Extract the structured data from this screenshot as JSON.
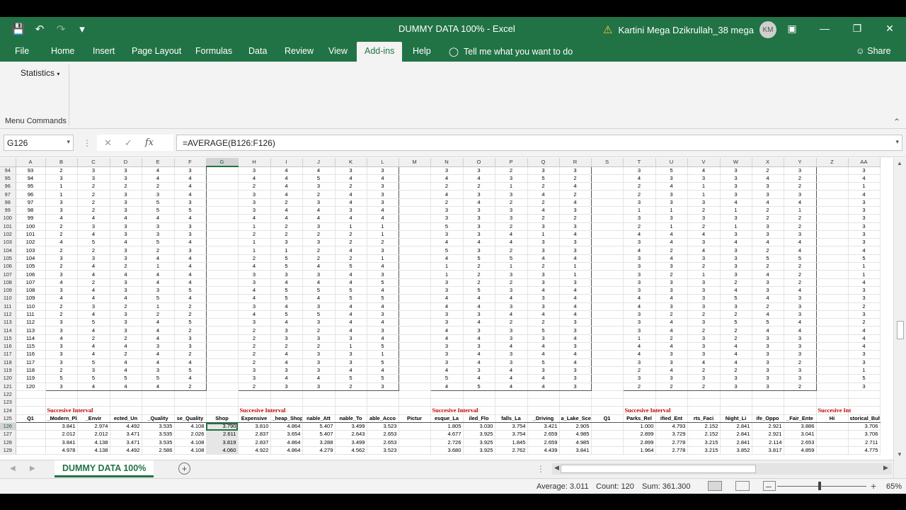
{
  "window": {
    "title": "DUMMY DATA 100%  -  Excel",
    "user_name": "Kartini Mega Dzikrullah_38 mega",
    "user_initials": "KM"
  },
  "quick_access": {
    "icons": [
      "save-icon",
      "undo-icon",
      "redo-icon",
      "customize-icon"
    ]
  },
  "ribbon": {
    "tabs": [
      {
        "label": "File"
      },
      {
        "label": "Home"
      },
      {
        "label": "Insert"
      },
      {
        "label": "Page Layout"
      },
      {
        "label": "Formulas"
      },
      {
        "label": "Data"
      },
      {
        "label": "Review"
      },
      {
        "label": "View"
      },
      {
        "label": "Add-ins",
        "active": true
      },
      {
        "label": "Help"
      }
    ],
    "tell_me": "Tell me what you want to do",
    "share": "Share",
    "statistics_button": "Statistics",
    "group_label": "Menu Commands"
  },
  "formula_bar": {
    "name_box": "G126",
    "formula": "=AVERAGE(B126:F126)"
  },
  "grid": {
    "columns": [
      "A",
      "B",
      "C",
      "D",
      "E",
      "F",
      "G",
      "H",
      "I",
      "J",
      "K",
      "L",
      "M",
      "N",
      "O",
      "P",
      "Q",
      "R",
      "S",
      "T",
      "U",
      "V",
      "W",
      "X",
      "Y",
      "Z",
      "AA"
    ],
    "selected_column": "G",
    "active_row": "126",
    "data_rows": [
      {
        "r": "94",
        "a": "93",
        "b1": [
          "2",
          "3",
          "3",
          "4",
          "3"
        ],
        "b2": [
          "3",
          "4",
          "4",
          "3",
          "3"
        ],
        "b3": [
          "3",
          "3",
          "2",
          "3",
          "3"
        ],
        "b4": [
          "3",
          "5",
          "4",
          "3",
          "2",
          "3"
        ],
        "aa": "3"
      },
      {
        "r": "95",
        "a": "94",
        "b1": [
          "3",
          "3",
          "3",
          "4",
          "4"
        ],
        "b2": [
          "4",
          "4",
          "5",
          "4",
          "4"
        ],
        "b3": [
          "4",
          "4",
          "3",
          "5",
          "2"
        ],
        "b4": [
          "4",
          "3",
          "3",
          "3",
          "4",
          "2"
        ],
        "aa": "4"
      },
      {
        "r": "96",
        "a": "95",
        "b1": [
          "1",
          "2",
          "2",
          "2",
          "4"
        ],
        "b2": [
          "2",
          "4",
          "3",
          "2",
          "3"
        ],
        "b3": [
          "2",
          "2",
          "1",
          "2",
          "4"
        ],
        "b4": [
          "2",
          "4",
          "1",
          "3",
          "3",
          "2"
        ],
        "aa": "1"
      },
      {
        "r": "97",
        "a": "96",
        "b1": [
          "1",
          "2",
          "3",
          "3",
          "4"
        ],
        "b2": [
          "3",
          "4",
          "2",
          "4",
          "3"
        ],
        "b3": [
          "4",
          "3",
          "3",
          "4",
          "2"
        ],
        "b4": [
          "2",
          "3",
          "1",
          "3",
          "3",
          "3"
        ],
        "aa": "4"
      },
      {
        "r": "98",
        "a": "97",
        "b1": [
          "3",
          "2",
          "3",
          "5",
          "3"
        ],
        "b2": [
          "3",
          "2",
          "3",
          "4",
          "3"
        ],
        "b3": [
          "2",
          "4",
          "2",
          "2",
          "4"
        ],
        "b4": [
          "3",
          "3",
          "3",
          "4",
          "4",
          "4"
        ],
        "aa": "3"
      },
      {
        "r": "99",
        "a": "98",
        "b1": [
          "3",
          "2",
          "3",
          "5",
          "5"
        ],
        "b2": [
          "3",
          "4",
          "4",
          "3",
          "4"
        ],
        "b3": [
          "3",
          "3",
          "3",
          "4",
          "3"
        ],
        "b4": [
          "1",
          "1",
          "2",
          "1",
          "2",
          "1"
        ],
        "aa": "3"
      },
      {
        "r": "100",
        "a": "99",
        "b1": [
          "4",
          "4",
          "4",
          "4",
          "4"
        ],
        "b2": [
          "4",
          "4",
          "4",
          "4",
          "4"
        ],
        "b3": [
          "3",
          "3",
          "3",
          "2",
          "2"
        ],
        "b4": [
          "3",
          "3",
          "3",
          "3",
          "2",
          "2"
        ],
        "aa": "3"
      },
      {
        "r": "101",
        "a": "100",
        "b1": [
          "2",
          "3",
          "3",
          "3",
          "3"
        ],
        "b2": [
          "1",
          "2",
          "3",
          "1",
          "1"
        ],
        "b3": [
          "5",
          "3",
          "2",
          "3",
          "3"
        ],
        "b4": [
          "2",
          "1",
          "2",
          "1",
          "3",
          "2"
        ],
        "aa": "3"
      },
      {
        "r": "102",
        "a": "101",
        "b1": [
          "2",
          "4",
          "3",
          "3",
          "3"
        ],
        "b2": [
          "2",
          "2",
          "2",
          "2",
          "1"
        ],
        "b3": [
          "3",
          "3",
          "4",
          "1",
          "4"
        ],
        "b4": [
          "4",
          "4",
          "4",
          "3",
          "3",
          "3"
        ],
        "aa": "3"
      },
      {
        "r": "103",
        "a": "102",
        "b1": [
          "4",
          "5",
          "4",
          "5",
          "4"
        ],
        "b2": [
          "1",
          "3",
          "3",
          "2",
          "2"
        ],
        "b3": [
          "4",
          "4",
          "4",
          "3",
          "3"
        ],
        "b4": [
          "3",
          "4",
          "3",
          "4",
          "4",
          "4"
        ],
        "aa": "3"
      },
      {
        "r": "104",
        "a": "103",
        "b1": [
          "2",
          "2",
          "3",
          "2",
          "3"
        ],
        "b2": [
          "1",
          "1",
          "2",
          "4",
          "3"
        ],
        "b3": [
          "5",
          "3",
          "2",
          "3",
          "3"
        ],
        "b4": [
          "4",
          "2",
          "4",
          "3",
          "2",
          "4"
        ],
        "aa": "4"
      },
      {
        "r": "105",
        "a": "104",
        "b1": [
          "3",
          "3",
          "3",
          "4",
          "4"
        ],
        "b2": [
          "2",
          "5",
          "2",
          "2",
          "1"
        ],
        "b3": [
          "4",
          "5",
          "5",
          "4",
          "4"
        ],
        "b4": [
          "3",
          "4",
          "3",
          "3",
          "5",
          "5"
        ],
        "aa": "5"
      },
      {
        "r": "106",
        "a": "105",
        "b1": [
          "2",
          "4",
          "2",
          "1",
          "4"
        ],
        "b2": [
          "4",
          "5",
          "4",
          "5",
          "4"
        ],
        "b3": [
          "1",
          "2",
          "1",
          "2",
          "1"
        ],
        "b4": [
          "3",
          "3",
          "2",
          "3",
          "2",
          "2"
        ],
        "aa": "1"
      },
      {
        "r": "107",
        "a": "106",
        "b1": [
          "3",
          "4",
          "4",
          "4",
          "4"
        ],
        "b2": [
          "3",
          "3",
          "3",
          "4",
          "3"
        ],
        "b3": [
          "1",
          "2",
          "3",
          "3",
          "1"
        ],
        "b4": [
          "3",
          "2",
          "1",
          "3",
          "4",
          "2"
        ],
        "aa": "1"
      },
      {
        "r": "108",
        "a": "107",
        "b1": [
          "4",
          "2",
          "3",
          "4",
          "4"
        ],
        "b2": [
          "3",
          "4",
          "4",
          "4",
          "5"
        ],
        "b3": [
          "3",
          "2",
          "2",
          "3",
          "3"
        ],
        "b4": [
          "3",
          "3",
          "3",
          "2",
          "3",
          "2"
        ],
        "aa": "4"
      },
      {
        "r": "109",
        "a": "108",
        "b1": [
          "3",
          "4",
          "3",
          "3",
          "5"
        ],
        "b2": [
          "4",
          "5",
          "5",
          "5",
          "4"
        ],
        "b3": [
          "3",
          "5",
          "3",
          "4",
          "4"
        ],
        "b4": [
          "3",
          "3",
          "3",
          "4",
          "3",
          "4"
        ],
        "aa": "3"
      },
      {
        "r": "110",
        "a": "109",
        "b1": [
          "4",
          "4",
          "4",
          "5",
          "4"
        ],
        "b2": [
          "4",
          "5",
          "4",
          "5",
          "5"
        ],
        "b3": [
          "4",
          "4",
          "4",
          "3",
          "4"
        ],
        "b4": [
          "4",
          "4",
          "3",
          "5",
          "4",
          "3"
        ],
        "aa": "3"
      },
      {
        "r": "111",
        "a": "110",
        "b1": [
          "2",
          "3",
          "2",
          "1",
          "2"
        ],
        "b2": [
          "3",
          "4",
          "3",
          "4",
          "4"
        ],
        "b3": [
          "4",
          "4",
          "3",
          "3",
          "4"
        ],
        "b4": [
          "4",
          "3",
          "3",
          "3",
          "2",
          "3"
        ],
        "aa": "2"
      },
      {
        "r": "112",
        "a": "111",
        "b1": [
          "2",
          "4",
          "3",
          "2",
          "2"
        ],
        "b2": [
          "4",
          "5",
          "5",
          "4",
          "3"
        ],
        "b3": [
          "3",
          "3",
          "4",
          "4",
          "4"
        ],
        "b4": [
          "3",
          "2",
          "2",
          "2",
          "4",
          "3"
        ],
        "aa": "3"
      },
      {
        "r": "113",
        "a": "112",
        "b1": [
          "3",
          "5",
          "3",
          "4",
          "5"
        ],
        "b2": [
          "3",
          "4",
          "3",
          "4",
          "4"
        ],
        "b3": [
          "3",
          "4",
          "2",
          "2",
          "3"
        ],
        "b4": [
          "3",
          "4",
          "3",
          "5",
          "5",
          "4"
        ],
        "aa": "2"
      },
      {
        "r": "114",
        "a": "113",
        "b1": [
          "3",
          "4",
          "3",
          "4",
          "2"
        ],
        "b2": [
          "2",
          "3",
          "2",
          "4",
          "3"
        ],
        "b3": [
          "4",
          "3",
          "3",
          "5",
          "3"
        ],
        "b4": [
          "3",
          "4",
          "2",
          "2",
          "4",
          "4"
        ],
        "aa": "4"
      },
      {
        "r": "115",
        "a": "114",
        "b1": [
          "4",
          "2",
          "2",
          "4",
          "3"
        ],
        "b2": [
          "2",
          "3",
          "3",
          "3",
          "4"
        ],
        "b3": [
          "4",
          "4",
          "3",
          "3",
          "4"
        ],
        "b4": [
          "1",
          "2",
          "3",
          "2",
          "3",
          "3"
        ],
        "aa": "4"
      },
      {
        "r": "116",
        "a": "115",
        "b1": [
          "3",
          "4",
          "4",
          "3",
          "3"
        ],
        "b2": [
          "2",
          "2",
          "2",
          "1",
          "5"
        ],
        "b3": [
          "3",
          "3",
          "4",
          "4",
          "3"
        ],
        "b4": [
          "4",
          "4",
          "3",
          "4",
          "3",
          "3"
        ],
        "aa": "4"
      },
      {
        "r": "117",
        "a": "116",
        "b1": [
          "3",
          "4",
          "2",
          "4",
          "2"
        ],
        "b2": [
          "2",
          "4",
          "3",
          "3",
          "1"
        ],
        "b3": [
          "3",
          "4",
          "3",
          "4",
          "4"
        ],
        "b4": [
          "4",
          "3",
          "3",
          "4",
          "3",
          "3"
        ],
        "aa": "3"
      },
      {
        "r": "118",
        "a": "117",
        "b1": [
          "3",
          "5",
          "4",
          "4",
          "4"
        ],
        "b2": [
          "2",
          "4",
          "3",
          "3",
          "5"
        ],
        "b3": [
          "3",
          "4",
          "3",
          "5",
          "4"
        ],
        "b4": [
          "3",
          "3",
          "4",
          "4",
          "3",
          "2"
        ],
        "aa": "3"
      },
      {
        "r": "119",
        "a": "118",
        "b1": [
          "2",
          "3",
          "4",
          "3",
          "5"
        ],
        "b2": [
          "3",
          "3",
          "3",
          "4",
          "4"
        ],
        "b3": [
          "4",
          "3",
          "4",
          "3",
          "3"
        ],
        "b4": [
          "2",
          "4",
          "2",
          "2",
          "3",
          "3"
        ],
        "aa": "1"
      },
      {
        "r": "120",
        "a": "119",
        "b1": [
          "5",
          "5",
          "5",
          "5",
          "4"
        ],
        "b2": [
          "3",
          "4",
          "4",
          "5",
          "5"
        ],
        "b3": [
          "5",
          "4",
          "4",
          "4",
          "3"
        ],
        "b4": [
          "3",
          "3",
          "3",
          "3",
          "3",
          "3"
        ],
        "aa": "5"
      },
      {
        "r": "121",
        "a": "120",
        "b1": [
          "3",
          "4",
          "4",
          "4",
          "2"
        ],
        "b2": [
          "2",
          "3",
          "3",
          "2",
          "3"
        ],
        "b3": [
          "4",
          "5",
          "4",
          "4",
          "3"
        ],
        "b4": [
          "2",
          "2",
          "2",
          "3",
          "3",
          "2"
        ],
        "aa": "3"
      }
    ],
    "blank_rows": [
      "122",
      "123"
    ],
    "interval_label_row": "124",
    "interval_label": "Succesive Interval",
    "interval_label_last": "Succesive Int",
    "header_row": {
      "r": "125",
      "a": "Q1",
      "b1": [
        "_Modern_Plan",
        "_Envir",
        "ected_Un",
        "_Quality",
        "se_Quality"
      ],
      "g": "Shop",
      "b2": [
        "Expensive",
        "_heap_Shop",
        "nable_Att",
        "nable_To",
        "able_Acco"
      ],
      "m": "Pictur",
      "b3": [
        "esque_La",
        "iled_Flo",
        "falls_La",
        "_Driving",
        "a_Lake_Scenery"
      ],
      "s": "Q1",
      "b4": [
        "Parks_Rel",
        "ified_Ent",
        "rts_Faci",
        "Night_Li",
        "ife_Oppo",
        "_Fair_Ente"
      ],
      "z": "Hi",
      "aa": "storical_Buh"
    },
    "sv_rows": [
      {
        "r": "126",
        "b1": [
          "3.841",
          "2.974",
          "4.492",
          "3.535",
          "4.108"
        ],
        "g": "3.790",
        "b2": [
          "3.810",
          "4.864",
          "5.407",
          "3.499",
          "3.523"
        ],
        "b3": [
          "1.805",
          "3.030",
          "3.754",
          "3.421",
          "2.905"
        ],
        "b4": [
          "1.000",
          "4.793",
          "2.152",
          "2.841",
          "2.921",
          "3.886"
        ],
        "aa": "3.706"
      },
      {
        "r": "127",
        "b1": [
          "2.012",
          "2.012",
          "3.471",
          "3.535",
          "2.026"
        ],
        "g": "2.611",
        "b2": [
          "2.837",
          "3.654",
          "5.407",
          "2.643",
          "2.653"
        ],
        "b3": [
          "4.677",
          "3.925",
          "3.754",
          "2.659",
          "4.985"
        ],
        "b4": [
          "2.899",
          "3.729",
          "2.152",
          "2.841",
          "2.921",
          "3.041"
        ],
        "aa": "3.706"
      },
      {
        "r": "128",
        "b1": [
          "3.841",
          "4.138",
          "3.471",
          "3.535",
          "4.108"
        ],
        "g": "3.819",
        "b2": [
          "2.837",
          "4.864",
          "3.288",
          "3.499",
          "2.653"
        ],
        "b3": [
          "2.726",
          "3.925",
          "1.845",
          "2.659",
          "4.985"
        ],
        "b4": [
          "2.899",
          "2.778",
          "3.215",
          "2.841",
          "2.114",
          "2.653"
        ],
        "aa": "2.711"
      },
      {
        "r": "129",
        "b1": [
          "4.978",
          "4.138",
          "4.492",
          "2.586",
          "4.108"
        ],
        "g": "4.060",
        "b2": [
          "4.922",
          "4.864",
          "4.279",
          "4.562",
          "3.523"
        ],
        "b3": [
          "3.680",
          "3.925",
          "2.762",
          "4.439",
          "3.841"
        ],
        "b4": [
          "1.964",
          "2.778",
          "3.215",
          "3.852",
          "3.817",
          "4.859"
        ],
        "aa": "4.775"
      }
    ]
  },
  "sheet_tab": "DUMMY DATA 100%",
  "status": {
    "average": "Average: 3.011",
    "count": "Count: 120",
    "sum": "Sum: 361.300",
    "zoom": "65%"
  }
}
